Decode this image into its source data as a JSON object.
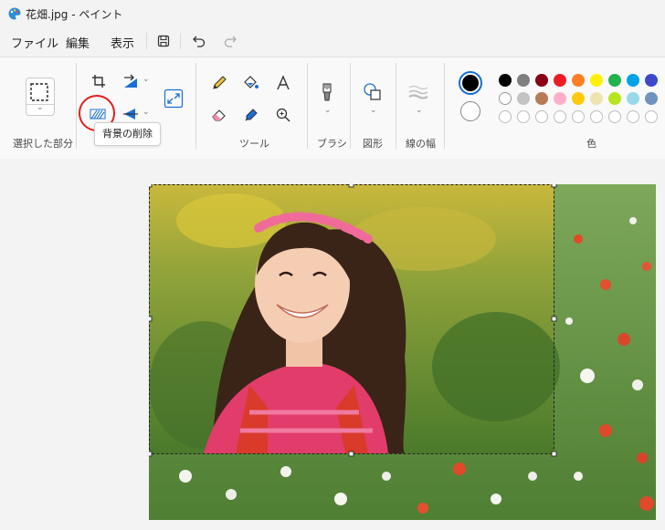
{
  "window": {
    "title": "花畑.jpg - ペイント"
  },
  "menu": {
    "file": "ファイル",
    "edit": "編集",
    "view": "表示"
  },
  "toolbar": {
    "save_icon": "save-icon",
    "undo_icon": "undo-icon",
    "redo_icon": "redo-icon"
  },
  "ribbon": {
    "selection_label": "選択した部分",
    "tools_label": "ツール",
    "brush_label": "ブラシ",
    "shapes_label": "図形",
    "line_width_label": "線の幅",
    "colors_label": "色",
    "tooltip": "背景の削除"
  },
  "colors": {
    "primary": "#000000",
    "secondary": "#ffffff",
    "row1": [
      "#000000",
      "#7f7f7f",
      "#880015",
      "#ed1c24",
      "#ff7f27",
      "#fff200",
      "#22b14c",
      "#00a2e8",
      "#3f48cc"
    ],
    "row2": [
      "#ffffff",
      "#c3c3c3",
      "#b97a57",
      "#ffaec9",
      "#ffc90e",
      "#efe4b0",
      "#b5e61d",
      "#99d9ea",
      "#7092be"
    ],
    "annotation": "#e02020"
  },
  "icons": [
    "crop-icon",
    "rotate-icon",
    "resize-icon",
    "remove-background-icon",
    "flip-icon",
    "pencil-icon",
    "fill-icon",
    "text-icon",
    "eraser-icon",
    "color-picker-icon",
    "magnifier-icon",
    "brush-icon",
    "shapes-icon",
    "line-width-icon"
  ]
}
